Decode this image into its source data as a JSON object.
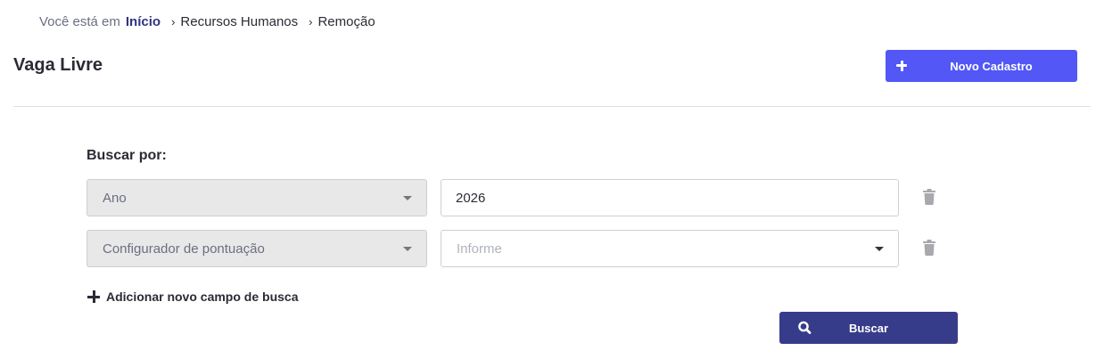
{
  "breadcrumb": {
    "prefix": "Você está em",
    "home": "Início",
    "items": [
      "Recursos Humanos",
      "Remoção"
    ]
  },
  "header": {
    "title": "Vaga Livre",
    "new_button_label": "Novo Cadastro"
  },
  "search": {
    "label": "Buscar por:",
    "rows": [
      {
        "field": "Ano",
        "value": "2026"
      },
      {
        "field": "Configurador de pontuação",
        "value_placeholder": "Informe"
      }
    ],
    "add_field_label": "Adicionar novo campo de busca",
    "search_button_label": "Buscar"
  },
  "icons": {
    "new": "plus-icon",
    "delete": "trash-icon",
    "add": "plus-icon",
    "search": "search-icon",
    "dropdown": "caret-down-icon",
    "separator": "chevron-right-icon"
  },
  "colors": {
    "primary": "#5257f5",
    "search_button": "#373c8a",
    "breadcrumb_home": "#2e3480",
    "select_background": "#e8e8e8"
  }
}
